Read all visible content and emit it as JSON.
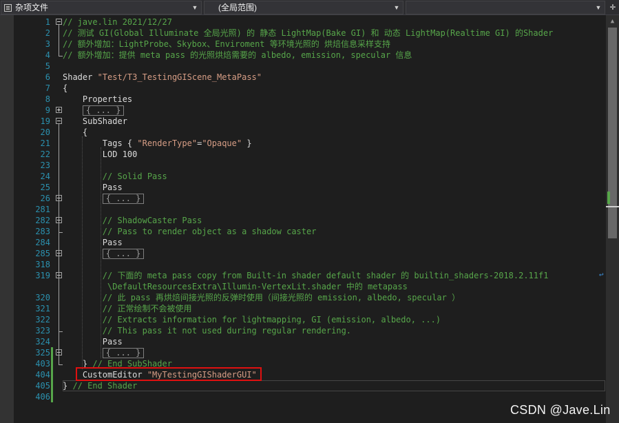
{
  "navbar": {
    "file_combo": "杂项文件",
    "scope_combo": "(全局范围)",
    "member_combo": "",
    "split_icon": "split-window-icon"
  },
  "editor": {
    "lines": [
      {
        "num": "1",
        "segments": [
          [
            "cm",
            "// jave.lin 2021/12/27"
          ]
        ]
      },
      {
        "num": "2",
        "segments": [
          [
            "cm",
            "// 测试 GI(Global Illuminate 全局光照) 的 静态 LightMap(Bake GI) 和 动态 LightMap(Realtime GI) 的Shader"
          ]
        ]
      },
      {
        "num": "3",
        "segments": [
          [
            "cm",
            "// 额外增加：LightProbe、Skybox、Enviroment 等环境光照的 烘焙信息采样支持"
          ]
        ]
      },
      {
        "num": "4",
        "segments": [
          [
            "cm",
            "// 额外增加：提供 meta pass 的光照烘焙需要的 albedo, emission, specular 信息"
          ]
        ]
      },
      {
        "num": "5",
        "segments": []
      },
      {
        "num": "6",
        "segments": [
          [
            "pl",
            "Shader "
          ],
          [
            "st",
            "\"Test/T3_TestingGIScene_MetaPass\""
          ]
        ]
      },
      {
        "num": "7",
        "segments": [
          [
            "pl",
            "{"
          ]
        ]
      },
      {
        "num": "8",
        "segments": [
          [
            "pl",
            "    Properties"
          ]
        ]
      },
      {
        "num": "9",
        "segments": [
          [
            "pl",
            "    "
          ],
          [
            "box",
            "{ ... }"
          ]
        ]
      },
      {
        "num": "19",
        "segments": [
          [
            "pl",
            "    SubShader"
          ]
        ]
      },
      {
        "num": "20",
        "segments": [
          [
            "pl",
            "    {"
          ]
        ]
      },
      {
        "num": "21",
        "segments": [
          [
            "pl",
            "        Tags { "
          ],
          [
            "st",
            "\"RenderType\""
          ],
          [
            "pl",
            "="
          ],
          [
            "st",
            "\"Opaque\""
          ],
          [
            "pl",
            " }"
          ]
        ]
      },
      {
        "num": "22",
        "segments": [
          [
            "pl",
            "        LOD 100"
          ]
        ]
      },
      {
        "num": "23",
        "segments": []
      },
      {
        "num": "24",
        "segments": [
          [
            "pl",
            "        "
          ],
          [
            "cm",
            "// Solid Pass"
          ]
        ]
      },
      {
        "num": "25",
        "segments": [
          [
            "pl",
            "        Pass"
          ]
        ]
      },
      {
        "num": "26",
        "segments": [
          [
            "pl",
            "        "
          ],
          [
            "box",
            "{ ... }"
          ]
        ]
      },
      {
        "num": "281",
        "segments": []
      },
      {
        "num": "282",
        "segments": [
          [
            "pl",
            "        "
          ],
          [
            "cm",
            "// ShadowCaster Pass"
          ]
        ]
      },
      {
        "num": "283",
        "segments": [
          [
            "pl",
            "        "
          ],
          [
            "cm",
            "// Pass to render object as a shadow caster"
          ]
        ]
      },
      {
        "num": "284",
        "segments": [
          [
            "pl",
            "        Pass"
          ]
        ]
      },
      {
        "num": "285",
        "segments": [
          [
            "pl",
            "        "
          ],
          [
            "box",
            "{ ... }"
          ]
        ]
      },
      {
        "num": "318",
        "segments": []
      },
      {
        "num": "319",
        "segments": [
          [
            "pl",
            "        "
          ],
          [
            "cm",
            "// 下面的 meta pass copy from Built-in shader default shader 的 builtin_shaders-2018.2.11f1"
          ]
        ]
      },
      {
        "num": "",
        "segments": [
          [
            "pl",
            "         "
          ],
          [
            "cm",
            "\\DefaultResourcesExtra\\Illumin-VertexLit.shader 中的 metapass"
          ]
        ]
      },
      {
        "num": "320",
        "segments": [
          [
            "pl",
            "        "
          ],
          [
            "cm",
            "// 此 pass 再烘焙间接光照的反弹时使用（间接光照的 emission, albedo, specular ）"
          ]
        ]
      },
      {
        "num": "321",
        "segments": [
          [
            "pl",
            "        "
          ],
          [
            "cm",
            "// 正常绘制不会被使用"
          ]
        ]
      },
      {
        "num": "322",
        "segments": [
          [
            "pl",
            "        "
          ],
          [
            "cm",
            "// Extracts information for lightmapping, GI (emission, albedo, ...)"
          ]
        ]
      },
      {
        "num": "323",
        "segments": [
          [
            "pl",
            "        "
          ],
          [
            "cm",
            "// This pass it not used during regular rendering."
          ]
        ]
      },
      {
        "num": "324",
        "segments": [
          [
            "pl",
            "        Pass"
          ]
        ]
      },
      {
        "num": "325",
        "segments": [
          [
            "pl",
            "        "
          ],
          [
            "box",
            "{ ... }"
          ]
        ]
      },
      {
        "num": "403",
        "segments": [
          [
            "pl",
            "    } "
          ],
          [
            "cm",
            "// End SubShader"
          ]
        ]
      },
      {
        "num": "404",
        "segments": [
          [
            "pl",
            "    CustomEditor "
          ],
          [
            "st",
            "\"MyTestingGIShaderGUI\""
          ]
        ]
      },
      {
        "num": "405",
        "segments": [
          [
            "pl",
            "} "
          ],
          [
            "cm",
            "// End Shader"
          ]
        ]
      },
      {
        "num": "406",
        "segments": []
      }
    ]
  },
  "watermark": "CSDN @Jave.Lin"
}
